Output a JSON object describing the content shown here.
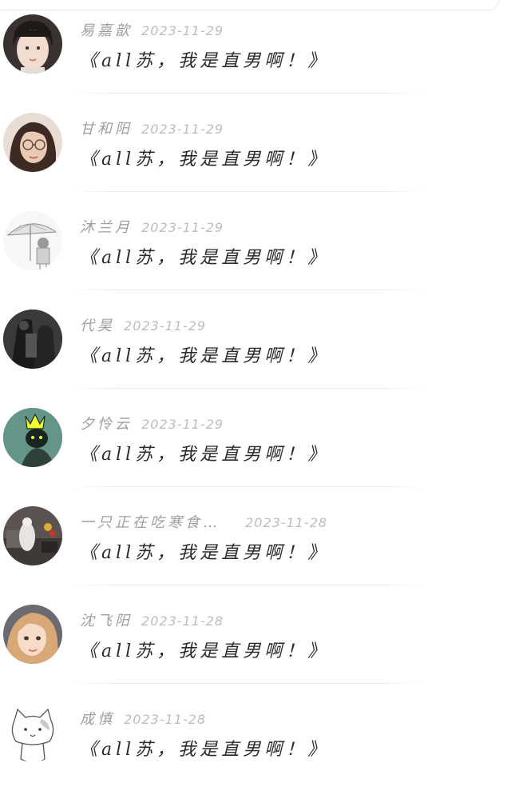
{
  "comments": [
    {
      "nickname": "易嘉歆",
      "date": "2023-11-29",
      "content": "《all苏，我是直男啊！》",
      "avatar_icon": "girl-portrait-avatar"
    },
    {
      "nickname": "甘和阳",
      "date": "2023-11-29",
      "content": "《all苏，我是直男啊！》",
      "avatar_icon": "girl-glasses-avatar"
    },
    {
      "nickname": "沐兰月",
      "date": "2023-11-29",
      "content": "《all苏，我是直男啊！》",
      "avatar_icon": "umbrella-sketch-avatar"
    },
    {
      "nickname": "代昊",
      "date": "2023-11-29",
      "content": "《all苏，我是直男啊！》",
      "avatar_icon": "dark-figure-avatar"
    },
    {
      "nickname": "夕怜云",
      "date": "2023-11-29",
      "content": "《all苏，我是直男啊！》",
      "avatar_icon": "crown-cartoon-avatar"
    },
    {
      "nickname": "一只正在吃寒食…",
      "date": "2023-11-28",
      "content": "《all苏，我是直男啊！》",
      "avatar_icon": "room-photo-avatar"
    },
    {
      "nickname": "沈飞阳",
      "date": "2023-11-28",
      "content": "《all苏，我是直男啊！》",
      "avatar_icon": "blonde-girl-avatar"
    },
    {
      "nickname": "成慎",
      "date": "2023-11-28",
      "content": "《all苏，我是直男啊！》",
      "avatar_icon": "white-cat-avatar"
    }
  ]
}
